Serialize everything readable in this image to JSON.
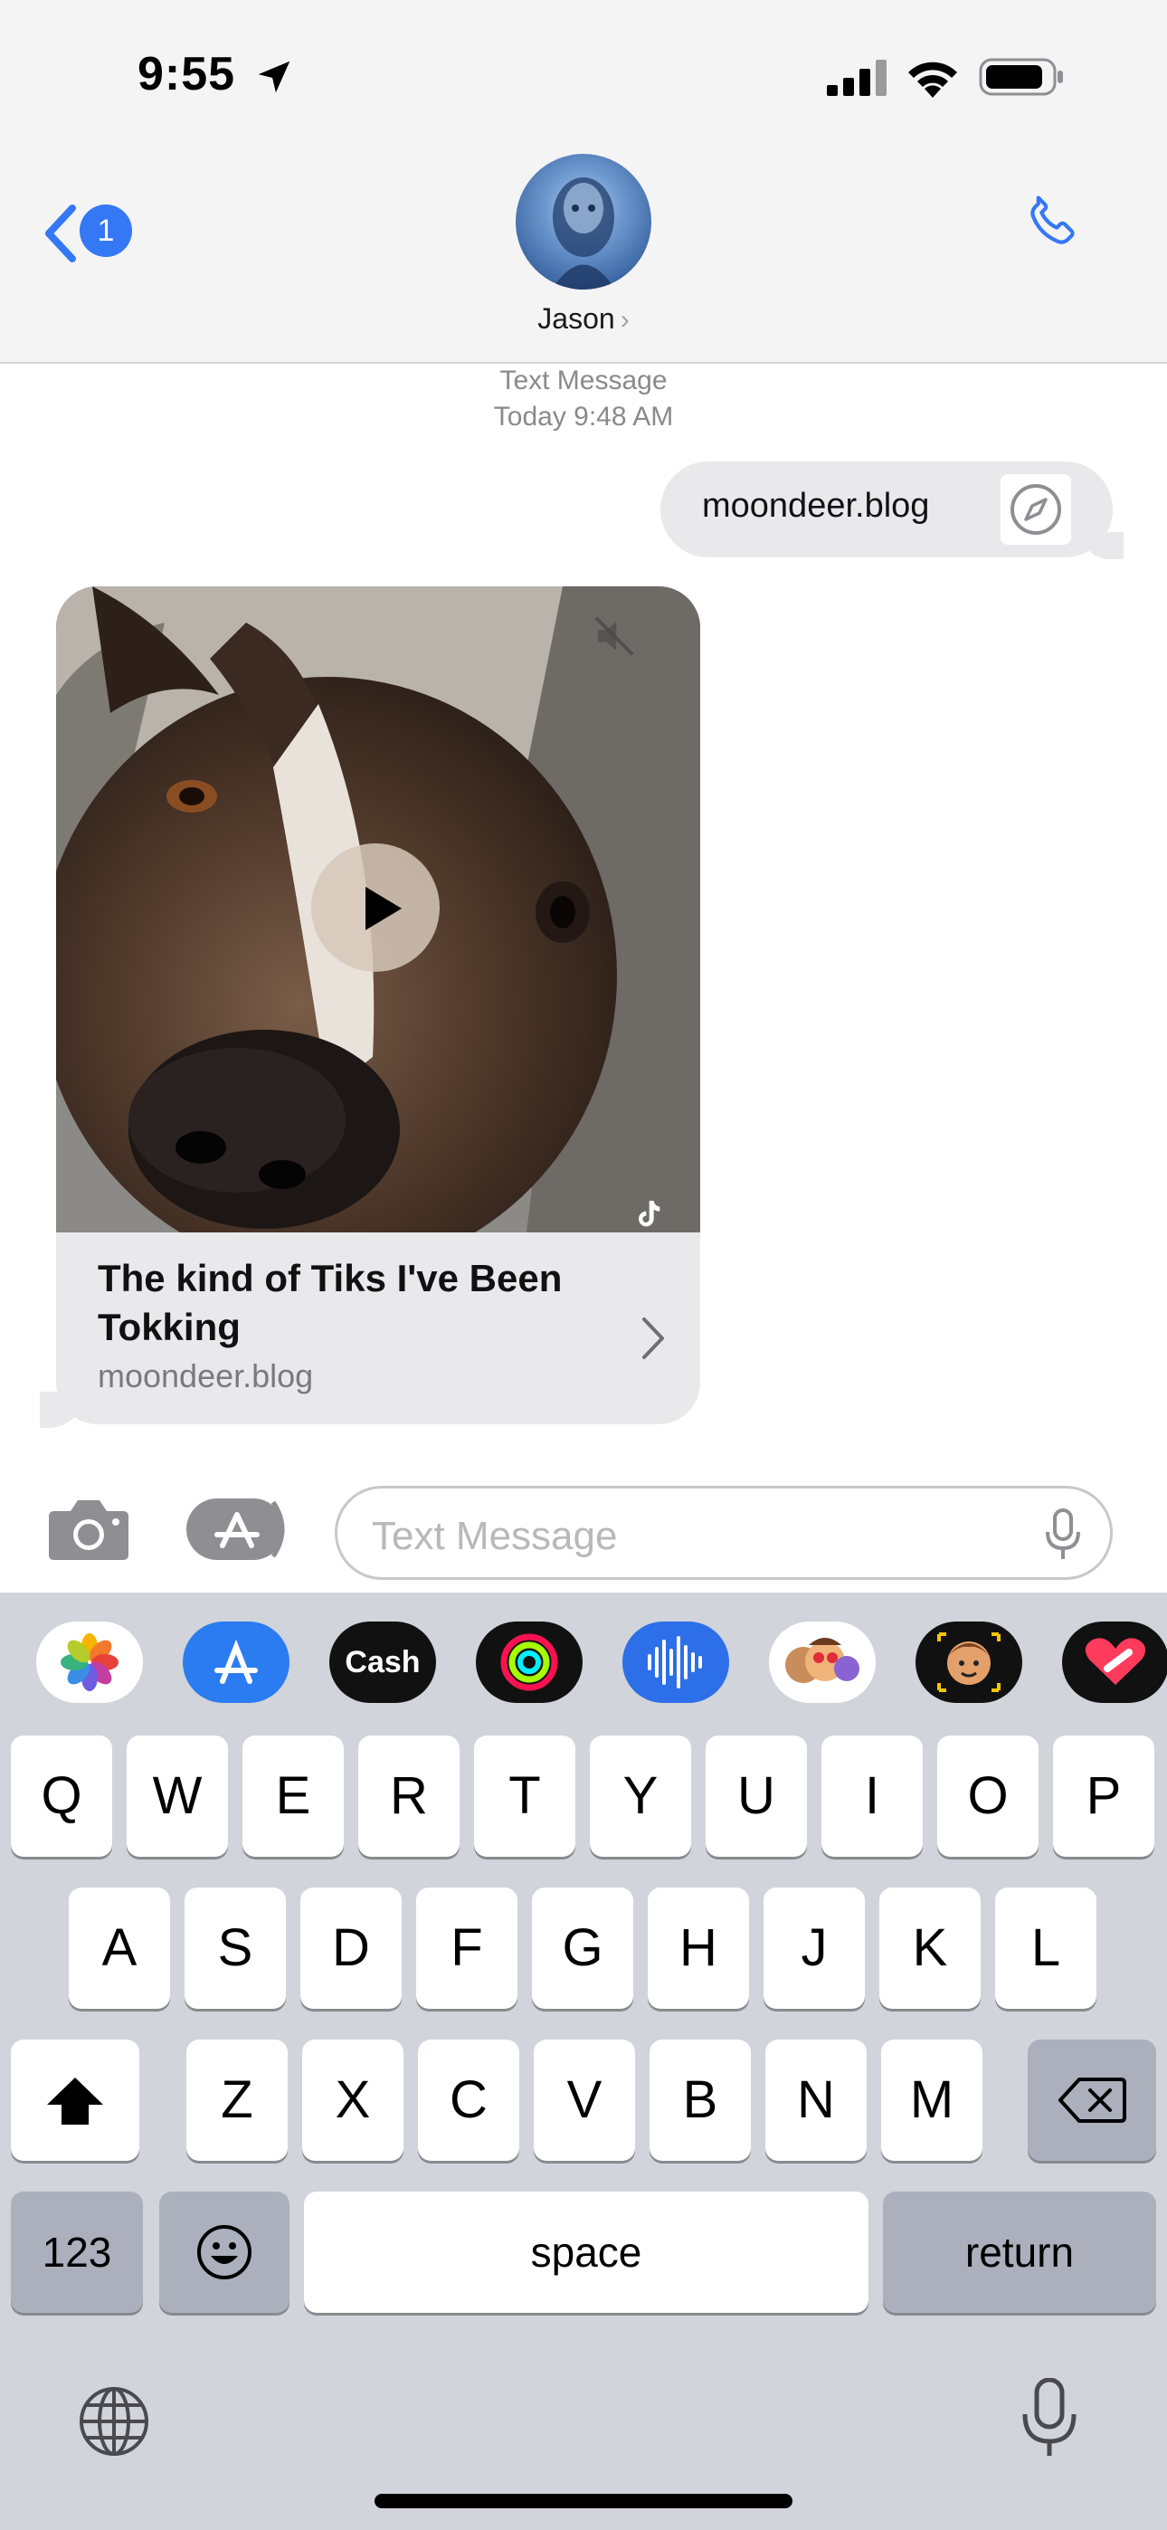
{
  "status_bar": {
    "time": "9:55"
  },
  "nav": {
    "back_count": "1",
    "contact_name": "Jason",
    "contact_chevron": "›"
  },
  "thread": {
    "service_label": "Text Message",
    "timestamp": "Today 9:48 AM",
    "outgoing": {
      "text": "moondeer.blog"
    },
    "link_preview": {
      "title": "The kind of Tiks I've Been Tokking",
      "domain": "moondeer.blog"
    }
  },
  "composer": {
    "placeholder": "Text Message"
  },
  "app_drawer": {
    "apps": [
      {
        "name": "photos-app-icon"
      },
      {
        "name": "app-store-app-icon"
      },
      {
        "name": "apple-cash-app-icon",
        "label": "Cash"
      },
      {
        "name": "fitness-app-icon"
      },
      {
        "name": "audio-message-app-icon"
      },
      {
        "name": "memoji-stickers-app-icon"
      },
      {
        "name": "animoji-app-icon"
      },
      {
        "name": "digital-touch-app-icon"
      }
    ]
  },
  "keyboard": {
    "row1": [
      "Q",
      "W",
      "E",
      "R",
      "T",
      "Y",
      "U",
      "I",
      "O",
      "P"
    ],
    "row2": [
      "A",
      "S",
      "D",
      "F",
      "G",
      "H",
      "J",
      "K",
      "L"
    ],
    "row3": [
      "Z",
      "X",
      "C",
      "V",
      "B",
      "N",
      "M"
    ],
    "numbers_key": "123",
    "space_key": "space",
    "return_key": "return"
  },
  "colors": {
    "accent": "#3478f6",
    "bubble_gray": "#e9e9eb",
    "keyboard_bg": "#d1d4da",
    "key_dark": "#abb0bc"
  }
}
